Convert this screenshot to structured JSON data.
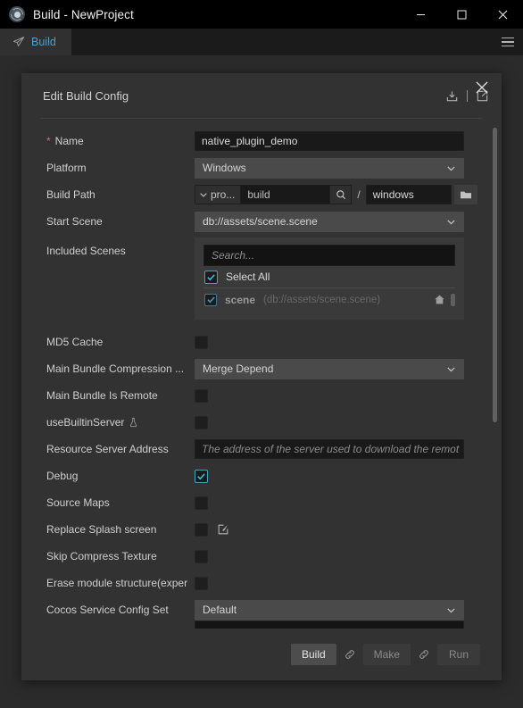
{
  "window": {
    "title": "Build - NewProject",
    "app_icon": "cocos-logo-icon",
    "minimize_label": "Minimize",
    "maximize_label": "Maximize",
    "close_label": "Close"
  },
  "tabs": [
    {
      "label": "Build",
      "icon": "paper-plane-icon",
      "active": true
    }
  ],
  "panel_menu": {
    "icon": "hamburger-menu-icon"
  },
  "dialog": {
    "title": "Edit Build Config",
    "actions": [
      {
        "name": "import-config-icon",
        "label": "Import"
      },
      {
        "name": "export-config-icon",
        "label": "Export"
      }
    ],
    "close_label": "Close"
  },
  "form": {
    "name": {
      "label": "Name",
      "required_marker": "*",
      "value": "native_plugin_demo"
    },
    "platform": {
      "label": "Platform",
      "value": "Windows"
    },
    "build_path": {
      "label": "Build Path",
      "root_value": "pro...",
      "folder_value": "build",
      "separator": "/",
      "sub_value": "windows",
      "search_icon": "magnifier-icon",
      "browse_icon": "folder-open-icon"
    },
    "start_scene": {
      "label": "Start Scene",
      "value": "db://assets/scene.scene"
    },
    "included_scenes": {
      "label": "Included Scenes",
      "search_placeholder": "Search...",
      "select_all": {
        "label": "Select All",
        "checked": true
      },
      "items": [
        {
          "label": "scene",
          "path": "(db://assets/scene.scene)",
          "checked": true,
          "home_icon": "home-icon"
        }
      ]
    },
    "md5_cache": {
      "label": "MD5 Cache",
      "checked": false
    },
    "main_bundle_compression": {
      "label": "Main Bundle Compression ...",
      "value": "Merge Depend"
    },
    "main_bundle_is_remote": {
      "label": "Main Bundle Is Remote",
      "checked": false
    },
    "use_builtin_server": {
      "label": "useBuiltinServer",
      "badge_icon": "experimental-flask-icon",
      "checked": false
    },
    "resource_server_address": {
      "label": "Resource Server Address",
      "placeholder": "The address of the server used to download the remot",
      "value": ""
    },
    "debug": {
      "label": "Debug",
      "checked": true
    },
    "source_maps": {
      "label": "Source Maps",
      "checked": false
    },
    "replace_splash_screen": {
      "label": "Replace Splash screen",
      "checked": false,
      "edit_icon": "edit-square-icon"
    },
    "skip_compress_texture": {
      "label": "Skip Compress Texture",
      "checked": false
    },
    "erase_module_structure": {
      "label": "Erase module structure(exper",
      "checked": false
    },
    "cocos_service_config_set": {
      "label": "Cocos Service Config Set",
      "value": "Default"
    }
  },
  "footer": {
    "build_label": "Build",
    "make_label": "Make",
    "run_label": "Run",
    "link_icon": "chain-link-icon"
  },
  "colors": {
    "accent_blue": "#4d9fd4",
    "checkbox_check": "#3fb3d6",
    "required_red": "#e06666",
    "panel_bg": "#2b2b2b",
    "dialog_bg": "#323232"
  }
}
